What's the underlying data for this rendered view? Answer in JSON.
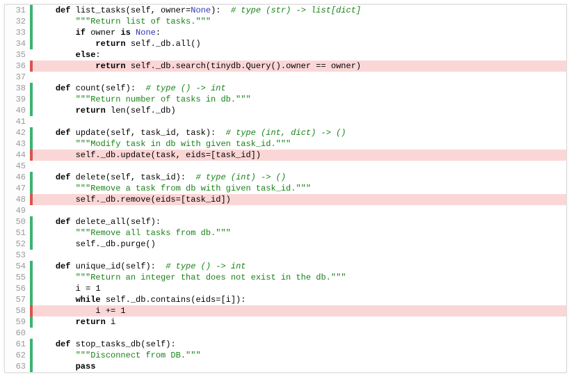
{
  "lines": [
    {
      "n": 31,
      "mark": "green",
      "cls": "",
      "tokens": [
        {
          "t": "    ",
          "c": ""
        },
        {
          "t": "def",
          "c": "kw"
        },
        {
          "t": " list_tasks(self, owner=",
          "c": ""
        },
        {
          "t": "None",
          "c": "blue"
        },
        {
          "t": "):  ",
          "c": ""
        },
        {
          "t": "# type (str) -> list[dict]",
          "c": "cmt"
        }
      ]
    },
    {
      "n": 32,
      "mark": "green",
      "cls": "",
      "tokens": [
        {
          "t": "        ",
          "c": ""
        },
        {
          "t": "\"\"\"Return list of tasks.\"\"\"",
          "c": "str"
        }
      ]
    },
    {
      "n": 33,
      "mark": "green",
      "cls": "",
      "tokens": [
        {
          "t": "        ",
          "c": ""
        },
        {
          "t": "if",
          "c": "kw"
        },
        {
          "t": " owner ",
          "c": ""
        },
        {
          "t": "is",
          "c": "kw"
        },
        {
          "t": " ",
          "c": ""
        },
        {
          "t": "None",
          "c": "blue"
        },
        {
          "t": ":",
          "c": ""
        }
      ]
    },
    {
      "n": 34,
      "mark": "green",
      "cls": "",
      "tokens": [
        {
          "t": "            ",
          "c": ""
        },
        {
          "t": "return",
          "c": "kw"
        },
        {
          "t": " self._db.all()",
          "c": ""
        }
      ]
    },
    {
      "n": 35,
      "mark": "",
      "cls": "",
      "tokens": [
        {
          "t": "        ",
          "c": ""
        },
        {
          "t": "else",
          "c": "kw"
        },
        {
          "t": ":",
          "c": ""
        }
      ]
    },
    {
      "n": 36,
      "mark": "red",
      "cls": "uncovered",
      "tokens": [
        {
          "t": "            ",
          "c": ""
        },
        {
          "t": "return",
          "c": "kw"
        },
        {
          "t": " self._db.search(tinydb.Query().owner == owner)",
          "c": ""
        }
      ]
    },
    {
      "n": 37,
      "mark": "",
      "cls": "",
      "tokens": []
    },
    {
      "n": 38,
      "mark": "green",
      "cls": "",
      "tokens": [
        {
          "t": "    ",
          "c": ""
        },
        {
          "t": "def",
          "c": "kw"
        },
        {
          "t": " count(self):  ",
          "c": ""
        },
        {
          "t": "# type () -> int",
          "c": "cmt"
        }
      ]
    },
    {
      "n": 39,
      "mark": "green",
      "cls": "",
      "tokens": [
        {
          "t": "        ",
          "c": ""
        },
        {
          "t": "\"\"\"Return number of tasks in db.\"\"\"",
          "c": "str"
        }
      ]
    },
    {
      "n": 40,
      "mark": "green",
      "cls": "",
      "tokens": [
        {
          "t": "        ",
          "c": ""
        },
        {
          "t": "return",
          "c": "kw"
        },
        {
          "t": " len(self._db)",
          "c": ""
        }
      ]
    },
    {
      "n": 41,
      "mark": "",
      "cls": "",
      "tokens": []
    },
    {
      "n": 42,
      "mark": "green",
      "cls": "",
      "tokens": [
        {
          "t": "    ",
          "c": ""
        },
        {
          "t": "def",
          "c": "kw"
        },
        {
          "t": " update(self, task_id, task):  ",
          "c": ""
        },
        {
          "t": "# type (int, dict) -> ()",
          "c": "cmt"
        }
      ]
    },
    {
      "n": 43,
      "mark": "green",
      "cls": "",
      "tokens": [
        {
          "t": "        ",
          "c": ""
        },
        {
          "t": "\"\"\"Modify task in db with given task_id.\"\"\"",
          "c": "str"
        }
      ]
    },
    {
      "n": 44,
      "mark": "red",
      "cls": "uncovered",
      "tokens": [
        {
          "t": "        self._db.update(task, eids=[task_id])",
          "c": ""
        }
      ]
    },
    {
      "n": 45,
      "mark": "",
      "cls": "",
      "tokens": []
    },
    {
      "n": 46,
      "mark": "green",
      "cls": "",
      "tokens": [
        {
          "t": "    ",
          "c": ""
        },
        {
          "t": "def",
          "c": "kw"
        },
        {
          "t": " delete(self, task_id):  ",
          "c": ""
        },
        {
          "t": "# type (int) -> ()",
          "c": "cmt"
        }
      ]
    },
    {
      "n": 47,
      "mark": "green",
      "cls": "",
      "tokens": [
        {
          "t": "        ",
          "c": ""
        },
        {
          "t": "\"\"\"Remove a task from db with given task_id.\"\"\"",
          "c": "str"
        }
      ]
    },
    {
      "n": 48,
      "mark": "red",
      "cls": "uncovered",
      "tokens": [
        {
          "t": "        self._db.remove(eids=[task_id])",
          "c": ""
        }
      ]
    },
    {
      "n": 49,
      "mark": "",
      "cls": "",
      "tokens": []
    },
    {
      "n": 50,
      "mark": "green",
      "cls": "",
      "tokens": [
        {
          "t": "    ",
          "c": ""
        },
        {
          "t": "def",
          "c": "kw"
        },
        {
          "t": " delete_all(self):",
          "c": ""
        }
      ]
    },
    {
      "n": 51,
      "mark": "green",
      "cls": "",
      "tokens": [
        {
          "t": "        ",
          "c": ""
        },
        {
          "t": "\"\"\"Remove all tasks from db.\"\"\"",
          "c": "str"
        }
      ]
    },
    {
      "n": 52,
      "mark": "green",
      "cls": "",
      "tokens": [
        {
          "t": "        self._db.purge()",
          "c": ""
        }
      ]
    },
    {
      "n": 53,
      "mark": "",
      "cls": "",
      "tokens": []
    },
    {
      "n": 54,
      "mark": "green",
      "cls": "",
      "tokens": [
        {
          "t": "    ",
          "c": ""
        },
        {
          "t": "def",
          "c": "kw"
        },
        {
          "t": " unique_id(self):  ",
          "c": ""
        },
        {
          "t": "# type () -> int",
          "c": "cmt"
        }
      ]
    },
    {
      "n": 55,
      "mark": "green",
      "cls": "",
      "tokens": [
        {
          "t": "        ",
          "c": ""
        },
        {
          "t": "\"\"\"Return an integer that does not exist in the db.\"\"\"",
          "c": "str"
        }
      ]
    },
    {
      "n": 56,
      "mark": "green",
      "cls": "",
      "tokens": [
        {
          "t": "        i = ",
          "c": ""
        },
        {
          "t": "1",
          "c": "num"
        }
      ]
    },
    {
      "n": 57,
      "mark": "green",
      "cls": "",
      "tokens": [
        {
          "t": "        ",
          "c": ""
        },
        {
          "t": "while",
          "c": "kw"
        },
        {
          "t": " self._db.contains(eids=[i]):",
          "c": ""
        }
      ]
    },
    {
      "n": 58,
      "mark": "red",
      "cls": "uncovered",
      "tokens": [
        {
          "t": "            i += ",
          "c": ""
        },
        {
          "t": "1",
          "c": "num"
        }
      ]
    },
    {
      "n": 59,
      "mark": "green",
      "cls": "",
      "tokens": [
        {
          "t": "        ",
          "c": ""
        },
        {
          "t": "return",
          "c": "kw"
        },
        {
          "t": " i",
          "c": ""
        }
      ]
    },
    {
      "n": 60,
      "mark": "",
      "cls": "",
      "tokens": []
    },
    {
      "n": 61,
      "mark": "green",
      "cls": "",
      "tokens": [
        {
          "t": "    ",
          "c": ""
        },
        {
          "t": "def",
          "c": "kw"
        },
        {
          "t": " stop_tasks_db(self):",
          "c": ""
        }
      ]
    },
    {
      "n": 62,
      "mark": "green",
      "cls": "",
      "tokens": [
        {
          "t": "        ",
          "c": ""
        },
        {
          "t": "\"\"\"Disconnect from DB.\"\"\"",
          "c": "str"
        }
      ]
    },
    {
      "n": 63,
      "mark": "green",
      "cls": "",
      "tokens": [
        {
          "t": "        ",
          "c": ""
        },
        {
          "t": "pass",
          "c": "kw"
        }
      ]
    }
  ]
}
